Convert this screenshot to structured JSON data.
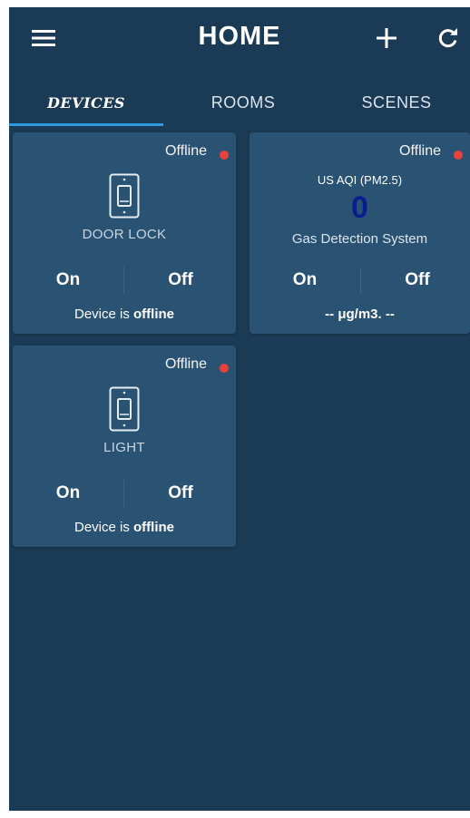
{
  "header": {
    "title": "HOME",
    "add_glyph": "+",
    "refresh_glyph": "↻"
  },
  "tabs": [
    {
      "label": "DEVICES",
      "active": true
    },
    {
      "label": "ROOMS",
      "active": false
    },
    {
      "label": "SCENES",
      "active": false
    }
  ],
  "colors": {
    "background": "#1b3a55",
    "card": "#2a5273",
    "accent": "#2f9ae0",
    "offline_dot": "#e8413c",
    "aqi_value": "#0a1d8e"
  },
  "devices": [
    {
      "status": "Offline",
      "icon": "switch-icon",
      "name": "DOOR LOCK",
      "on_label": "On",
      "off_label": "Off",
      "footer_prefix": "Device is ",
      "footer_bold": "offline"
    },
    {
      "status": "Offline",
      "aqi_label": "US AQI (PM2.5)",
      "aqi_value": "0",
      "name": "Gas Detection System",
      "on_label": "On",
      "off_label": "Off",
      "footer": "-- μg/m3. --"
    },
    {
      "status": "Offline",
      "icon": "switch-icon",
      "name": "LIGHT",
      "on_label": "On",
      "off_label": "Off",
      "footer_prefix": "Device is ",
      "footer_bold": "offline"
    }
  ]
}
